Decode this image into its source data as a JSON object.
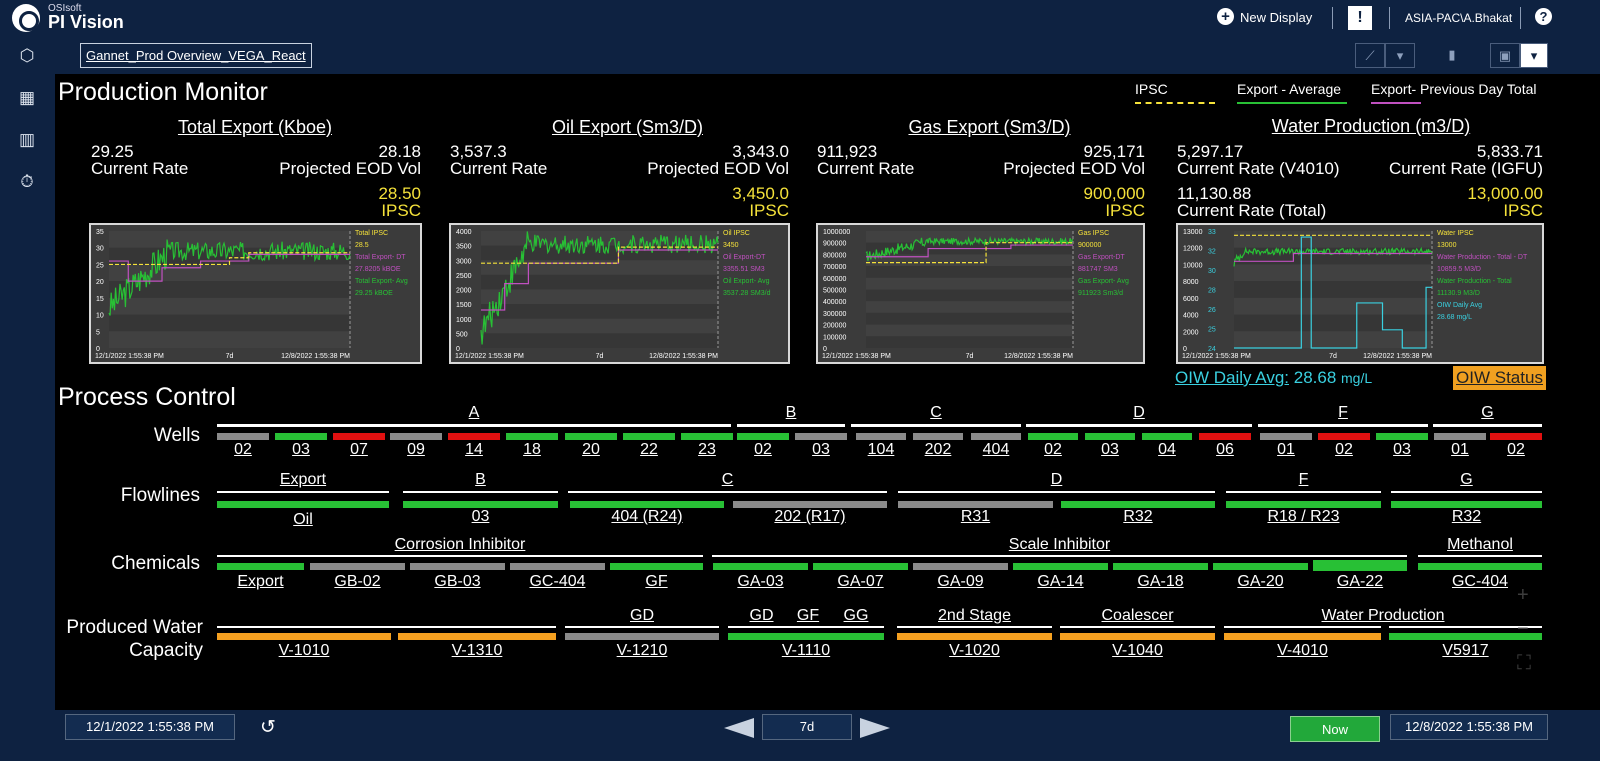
{
  "app": {
    "brand_small": "OSIsoft",
    "brand": "PI Vision"
  },
  "topbar": {
    "new_display": "New Display",
    "user": "ASIA-PAC\\A.Bhakat",
    "alert_icon": "!",
    "help_icon": "?"
  },
  "display": {
    "name": "Gannet_Prod Overview_VEGA_React"
  },
  "production_monitor": {
    "title": "Production Monitor",
    "legend": [
      {
        "label": "IPSC",
        "color": "#f5e23a"
      },
      {
        "label": "Export - Average",
        "color": "#28c035"
      },
      {
        "label": "Export- Previous Day Total",
        "color": "#c050c0"
      }
    ],
    "kpis": [
      {
        "title": "Total Export (Kboe)",
        "left_value": "29.25",
        "left_label": "Current Rate",
        "right_value": "28.18",
        "right_label": "Projected EOD Vol",
        "ipsc_value": "28.50",
        "ipsc_label": "IPSC"
      },
      {
        "title": "Oil Export (Sm3/D)",
        "left_value": "3,537.3",
        "left_label": "Current Rate",
        "right_value": "3,343.0",
        "right_label": "Projected EOD Vol",
        "ipsc_value": "3,450.0",
        "ipsc_label": "IPSC"
      },
      {
        "title": "Gas Export (Sm3/D)",
        "left_value": "911,923",
        "left_label": "Current Rate",
        "right_value": "925,171",
        "right_label": "Projected EOD Vol",
        "ipsc_value": "900,000",
        "ipsc_label": "IPSC"
      },
      {
        "title": "Water Production (m3/D)",
        "left_value": "5,297.17",
        "left_label": "Current Rate (V4010)",
        "right_value": "5,833.71",
        "right_label": "Current Rate (IGFU)",
        "extra_value": "11,130.88",
        "extra_label": "Current Rate (Total)",
        "ipsc_value": "13,000.00",
        "ipsc_label": "IPSC"
      }
    ]
  },
  "charts": [
    {
      "yticks": [
        "35",
        "30",
        "25",
        "20",
        "15",
        "10",
        "5",
        "0"
      ],
      "ymax": 35,
      "x_start": "12/1/2022 1:55:38 PM",
      "x_mid": "7d",
      "x_end": "12/8/2022 1:55:38 PM",
      "legend": [
        {
          "text": "Total IPSC",
          "color": "#f5e23a"
        },
        {
          "text": "28.5",
          "color": "#f5e23a"
        },
        {
          "text": "Total Export- DT",
          "color": "#c050c0"
        },
        {
          "text": "27.8205 kBOE",
          "color": "#c050c0"
        },
        {
          "text": "Total Export- Avg",
          "color": "#28c035"
        },
        {
          "text": "29.25 kBOE",
          "color": "#28c035"
        }
      ],
      "series": {
        "ipsc": [
          [
            0,
            25
          ],
          [
            0.5,
            25
          ],
          [
            0.5,
            27
          ],
          [
            0.58,
            27
          ],
          [
            0.58,
            28.5
          ],
          [
            1,
            28.5
          ]
        ],
        "dt": [
          [
            0,
            26
          ],
          [
            0.08,
            26
          ],
          [
            0.08,
            20
          ],
          [
            0.22,
            20
          ],
          [
            0.22,
            24
          ],
          [
            0.38,
            24
          ],
          [
            0.38,
            26
          ],
          [
            0.58,
            26
          ],
          [
            0.58,
            28
          ],
          [
            1,
            28
          ]
        ],
        "avg": {
          "start": 12,
          "end": 29,
          "noise": 3.5,
          "rise": 0.25
        }
      }
    },
    {
      "yticks": [
        "4000",
        "3500",
        "3000",
        "2500",
        "2000",
        "1500",
        "1000",
        "500",
        "0"
      ],
      "ymax": 4000,
      "x_start": "12/1/2022 1:55:38 PM",
      "x_mid": "7d",
      "x_end": "12/8/2022 1:55:38 PM",
      "legend": [
        {
          "text": "Oil IPSC",
          "color": "#f5e23a"
        },
        {
          "text": "3450",
          "color": "#f5e23a"
        },
        {
          "text": "Oil Export-DT",
          "color": "#c050c0"
        },
        {
          "text": "3355.51 SM3",
          "color": "#c050c0"
        },
        {
          "text": "Oil Export- Avg",
          "color": "#28c035"
        },
        {
          "text": "3537.28 SM3/d",
          "color": "#28c035"
        }
      ],
      "series": {
        "ipsc": [
          [
            0,
            2900
          ],
          [
            0.58,
            2900
          ],
          [
            0.58,
            3450
          ],
          [
            1,
            3450
          ]
        ],
        "dt": [
          [
            0,
            1300
          ],
          [
            0.1,
            1300
          ],
          [
            0.1,
            2200
          ],
          [
            0.2,
            2200
          ],
          [
            0.2,
            2900
          ],
          [
            0.58,
            2900
          ],
          [
            0.58,
            3350
          ],
          [
            1,
            3350
          ]
        ],
        "avg": {
          "start": 500,
          "end": 3550,
          "noise": 400,
          "rise": 0.2
        }
      }
    },
    {
      "yticks": [
        "1000000",
        "900000",
        "800000",
        "700000",
        "600000",
        "500000",
        "400000",
        "300000",
        "200000",
        "100000",
        "0"
      ],
      "ymax": 1000000,
      "x_start": "12/1/2022 1:55:38 PM",
      "x_mid": "7d",
      "x_end": "12/8/2022 1:55:38 PM",
      "legend": [
        {
          "text": "Gas IPSC",
          "color": "#f5e23a"
        },
        {
          "text": "900000",
          "color": "#f5e23a"
        },
        {
          "text": "Gas Export-DT",
          "color": "#c050c0"
        },
        {
          "text": "881747 SM3",
          "color": "#c050c0"
        },
        {
          "text": "Gas Export- Avg",
          "color": "#28c035"
        },
        {
          "text": "911923 Sm3/d",
          "color": "#28c035"
        }
      ],
      "series": {
        "ipsc": [
          [
            0,
            730000
          ],
          [
            0.58,
            730000
          ],
          [
            0.58,
            900000
          ],
          [
            1,
            900000
          ]
        ],
        "dt": [
          [
            0,
            780000
          ],
          [
            0.3,
            780000
          ],
          [
            0.3,
            850000
          ],
          [
            0.7,
            850000
          ],
          [
            0.7,
            880000
          ],
          [
            1,
            880000
          ]
        ],
        "avg": {
          "start": 780000,
          "end": 912000,
          "noise": 35000,
          "rise": 0.3
        }
      }
    },
    {
      "yticks": [
        "13000",
        "12000",
        "10000",
        "8000",
        "6000",
        "4000",
        "2000",
        "0"
      ],
      "ymax": 13500,
      "y2ticks": [
        "33",
        "32",
        "30",
        "28",
        "26",
        "25",
        "24"
      ],
      "x_start": "12/1/2022 1:55:38 PM",
      "x_mid": "7d",
      "x_end": "12/8/2022 1:55:38 PM",
      "legend": [
        {
          "text": "Water IPSC",
          "color": "#f5e23a"
        },
        {
          "text": "13000",
          "color": "#f5e23a"
        },
        {
          "text": "Water Production - Total - DT",
          "color": "#c050c0"
        },
        {
          "text": "10859.5 M3/D",
          "color": "#c050c0"
        },
        {
          "text": "Water Production - Total",
          "color": "#28c035"
        },
        {
          "text": "11130.9 M3/D",
          "color": "#28c035"
        },
        {
          "text": "OIW Daily Avg",
          "color": "#3ad0e0"
        },
        {
          "text": "28.68 mg/L",
          "color": "#3ad0e0"
        }
      ],
      "series": {
        "ipsc": [
          [
            0,
            13000
          ],
          [
            1,
            13000
          ]
        ],
        "dt": [
          [
            0,
            10000
          ],
          [
            0.3,
            10000
          ],
          [
            0.3,
            10900
          ],
          [
            1,
            10900
          ]
        ],
        "avg": {
          "start": 9800,
          "end": 11130,
          "noise": 450,
          "rise": 0.05
        },
        "oiw": [
          [
            0,
            0.2
          ],
          [
            0.34,
            0.2
          ],
          [
            0.34,
            12800
          ],
          [
            0.39,
            12800
          ],
          [
            0.39,
            0.2
          ],
          [
            0.62,
            0.2
          ],
          [
            0.62,
            5200
          ],
          [
            0.75,
            5200
          ],
          [
            0.75,
            2100
          ],
          [
            0.85,
            2100
          ],
          [
            0.85,
            0.2
          ],
          [
            0.97,
            0.2
          ],
          [
            0.97,
            7000
          ],
          [
            1,
            7000
          ]
        ]
      }
    }
  ],
  "oiw": {
    "label": "OIW Daily Avg:",
    "value": "28.68",
    "unit": "mg/L",
    "status": "OIW Status"
  },
  "process_control": {
    "title": "Process Control",
    "row_labels": {
      "wells": "Wells",
      "flowlines": "Flowlines",
      "chemicals": "Chemicals",
      "water_1": "Produced Water",
      "water_2": "Capacity"
    },
    "well_groups": [
      "A",
      "B",
      "C",
      "D",
      "F",
      "G"
    ],
    "wells": [
      {
        "label": "02",
        "status": "gy"
      },
      {
        "label": "03",
        "status": "g"
      },
      {
        "label": "07",
        "status": "r"
      },
      {
        "label": "09",
        "status": "gy"
      },
      {
        "label": "14",
        "status": "r"
      },
      {
        "label": "18",
        "status": "g"
      },
      {
        "label": "20",
        "status": "g"
      },
      {
        "label": "22",
        "status": "g"
      },
      {
        "label": "23",
        "status": "g"
      },
      {
        "label": "02",
        "status": "g"
      },
      {
        "label": "03",
        "status": "gy"
      },
      {
        "label": "104",
        "status": "gy"
      },
      {
        "label": "202",
        "status": "gy"
      },
      {
        "label": "404",
        "status": "gy"
      },
      {
        "label": "02",
        "status": "g"
      },
      {
        "label": "03",
        "status": "g"
      },
      {
        "label": "04",
        "status": "g"
      },
      {
        "label": "06",
        "status": "r"
      },
      {
        "label": "01",
        "status": "gy"
      },
      {
        "label": "02",
        "status": "r"
      },
      {
        "label": "03",
        "status": "g"
      },
      {
        "label": "01",
        "status": "gy"
      },
      {
        "label": "02",
        "status": "r"
      }
    ],
    "flowline_groups": [
      "Export",
      "B",
      "C",
      "D",
      "F",
      "G"
    ],
    "flowlines": [
      {
        "label": "Oil",
        "status": "g"
      },
      {
        "label": "03",
        "status": "g"
      },
      {
        "label": "404 (R24)",
        "status": "g"
      },
      {
        "label": "202 (R17)",
        "status": "gy"
      },
      {
        "label": "R31",
        "status": "gy"
      },
      {
        "label": "R32",
        "status": "g"
      },
      {
        "label": "R18 / R23",
        "status": "g"
      },
      {
        "label": "R32",
        "status": "g"
      }
    ],
    "chemical_groups": [
      "Corrosion Inhibitor",
      "Scale Inhibitor",
      "Methanol"
    ],
    "chemicals": [
      {
        "label": "Export",
        "status": "g"
      },
      {
        "label": "GB-02",
        "status": "gy"
      },
      {
        "label": "GB-03",
        "status": "gy"
      },
      {
        "label": "GC-404",
        "status": "gy"
      },
      {
        "label": "GF",
        "status": "g"
      },
      {
        "label": "GA-03",
        "status": "g"
      },
      {
        "label": "GA-07",
        "status": "g"
      },
      {
        "label": "GA-09",
        "status": "gy"
      },
      {
        "label": "GA-14",
        "status": "g"
      },
      {
        "label": "GA-18",
        "status": "g"
      },
      {
        "label": "GA-20",
        "status": "g"
      },
      {
        "label": "GA-22",
        "status": "g"
      },
      {
        "label": "GC-404",
        "status": "g"
      }
    ],
    "water_groups": [
      "GD",
      "GD",
      "GF",
      "GG",
      "2nd Stage",
      "Coalescer",
      "Water Production"
    ],
    "water": [
      {
        "label": "V-1010",
        "status": "o"
      },
      {
        "label": "V-1310",
        "status": "o"
      },
      {
        "label": "V-1210",
        "status": "gy"
      },
      {
        "label": "V-1110",
        "status": "g"
      },
      {
        "label": "V-1020",
        "status": "o"
      },
      {
        "label": "V-1040",
        "status": "o"
      },
      {
        "label": "V-4010",
        "status": "o"
      },
      {
        "label": "V5917",
        "status": "g"
      }
    ]
  },
  "timebar": {
    "start": "12/1/2022 1:55:38 PM",
    "duration": "7d",
    "now": "Now",
    "end": "12/8/2022 1:55:38 PM"
  }
}
